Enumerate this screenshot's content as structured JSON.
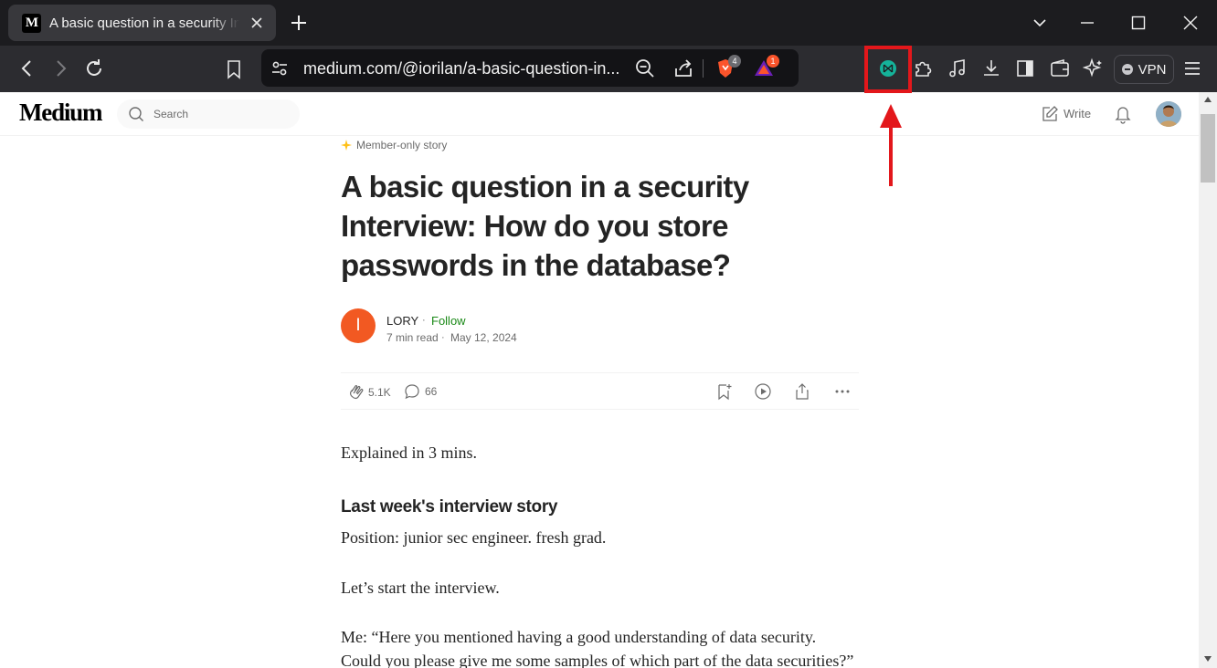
{
  "browser": {
    "tab": {
      "favicon_text": "M",
      "title": "A basic question in a security Interview"
    },
    "url": "medium.com/@iorilan/a-basic-question-in...",
    "brave_badge": "4",
    "rewards_badge": "1",
    "vpn_label": "VPN"
  },
  "header": {
    "logo": "Medium",
    "search_placeholder": "Search",
    "write_label": "Write"
  },
  "article": {
    "member_label": "Member-only story",
    "title": "A basic question in a security Interview: How do you store passwords in the database?",
    "author": {
      "initial": "I",
      "name": "LORY",
      "follow": "Follow",
      "read_time": "7 min read",
      "date": "May 12, 2024"
    },
    "claps": "5.1K",
    "comments": "66",
    "paragraphs": {
      "intro": "Explained in 3 mins.",
      "heading": "Last week's interview story",
      "position": "Position: junior sec engineer. fresh grad.",
      "start": "Let’s start the interview.",
      "me_line1": "Me: “Here you mentioned having a good understanding of data security.",
      "me_line2": "Could you please give me some samples of which part of the data securities?”"
    }
  },
  "colors": {
    "highlight": "#e3171b",
    "follow_green": "#1a8917",
    "author_avatar": "#f25922"
  }
}
